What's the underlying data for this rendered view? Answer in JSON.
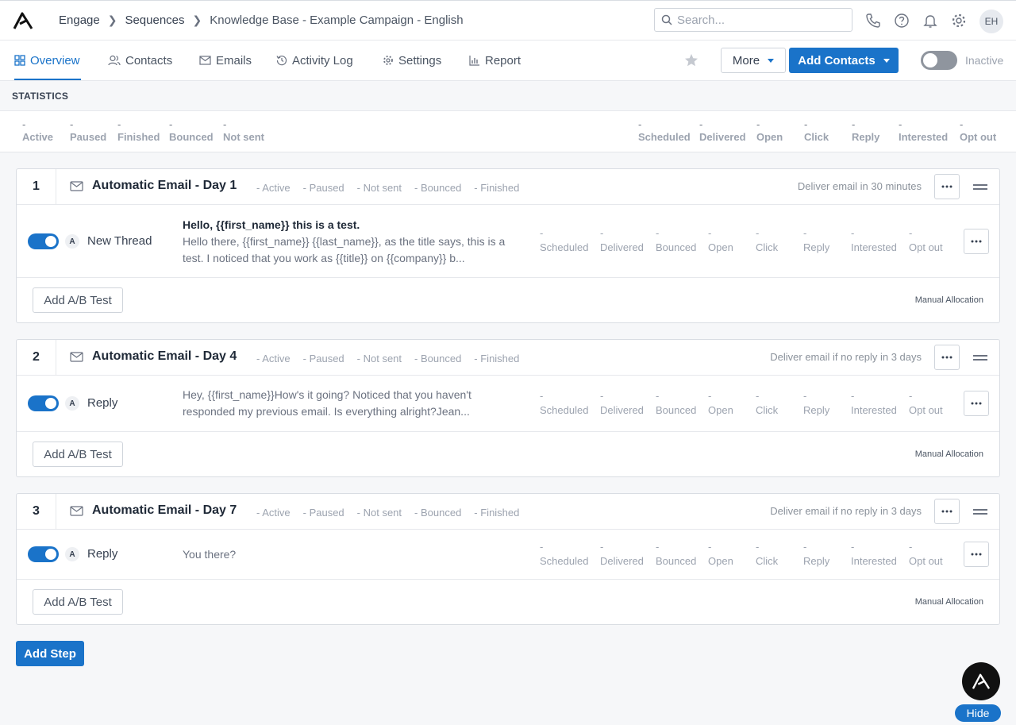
{
  "header": {
    "breadcrumbs": [
      "Engage",
      "Sequences",
      "Knowledge Base - Example Campaign - English"
    ],
    "search_placeholder": "Search...",
    "avatar_initials": "EH"
  },
  "nav": {
    "tabs": [
      "Overview",
      "Contacts",
      "Emails",
      "Activity Log",
      "Settings",
      "Report"
    ],
    "more_label": "More",
    "add_contacts_label": "Add Contacts",
    "status_label": "Inactive"
  },
  "statistics": {
    "title": "STATISTICS",
    "left": [
      {
        "value": "-",
        "label": "Active"
      },
      {
        "value": "-",
        "label": "Paused"
      },
      {
        "value": "-",
        "label": "Finished"
      },
      {
        "value": "-",
        "label": "Bounced"
      },
      {
        "value": "-",
        "label": "Not sent"
      }
    ],
    "right": [
      {
        "value": "-",
        "label": "Scheduled"
      },
      {
        "value": "-",
        "label": "Delivered"
      },
      {
        "value": "-",
        "label": "Open"
      },
      {
        "value": "-",
        "label": "Click"
      },
      {
        "value": "-",
        "label": "Reply"
      },
      {
        "value": "-",
        "label": "Interested"
      },
      {
        "value": "-",
        "label": "Opt out"
      }
    ]
  },
  "steps": [
    {
      "number": "1",
      "title": "Automatic Email - Day 1",
      "head_stats": [
        "- Active",
        "- Paused",
        "- Not sent",
        "- Bounced",
        "- Finished"
      ],
      "delivery": "Deliver email in 30 minutes",
      "variant": {
        "badge": "A",
        "thread": "New Thread",
        "subject": "Hello, {{first_name}} this is a test.",
        "body": "Hello there, {{first_name}} {{last_name}}, as the title says, this is a test. I noticed that you work as {{title}} on {{company}} b..."
      },
      "ab_label": "Add A/B Test",
      "allocation": "Manual Allocation"
    },
    {
      "number": "2",
      "title": "Automatic Email - Day 4",
      "head_stats": [
        "- Active",
        "- Paused",
        "- Not sent",
        "- Bounced",
        "- Finished"
      ],
      "delivery": "Deliver email if no reply in 3 days",
      "variant": {
        "badge": "A",
        "thread": "Reply",
        "subject": "",
        "body": "Hey, {{first_name}}How's it going? Noticed that you haven't responded my previous email. Is everything alright?Jean..."
      },
      "ab_label": "Add A/B Test",
      "allocation": "Manual Allocation"
    },
    {
      "number": "3",
      "title": "Automatic Email - Day 7",
      "head_stats": [
        "- Active",
        "- Paused",
        "- Not sent",
        "- Bounced",
        "- Finished"
      ],
      "delivery": "Deliver email if no reply in 3 days",
      "variant": {
        "badge": "A",
        "thread": "Reply",
        "subject": "",
        "body": "You there?"
      },
      "ab_label": "Add A/B Test",
      "allocation": "Manual Allocation"
    }
  ],
  "variant_stats": [
    {
      "value": "-",
      "label": "Scheduled"
    },
    {
      "value": "-",
      "label": "Delivered"
    },
    {
      "value": "-",
      "label": "Bounced"
    },
    {
      "value": "-",
      "label": "Open"
    },
    {
      "value": "-",
      "label": "Click"
    },
    {
      "value": "-",
      "label": "Reply"
    },
    {
      "value": "-",
      "label": "Interested"
    },
    {
      "value": "-",
      "label": "Opt out"
    }
  ],
  "actions": {
    "add_step_label": "Add Step",
    "hide_label": "Hide"
  },
  "colors": {
    "accent": "#1a73c9",
    "toggle_off": "#8f959e"
  }
}
